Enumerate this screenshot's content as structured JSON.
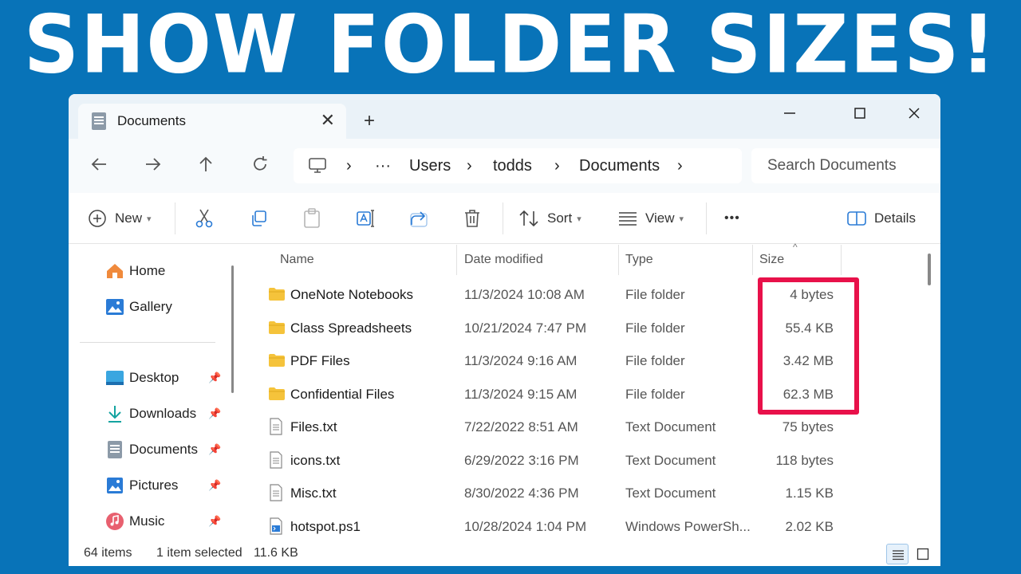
{
  "headline": "SHOW FOLDER SIZES!",
  "window": {
    "tab_title": "Documents",
    "new_tab_label": "+",
    "breadcrumb": [
      "Users",
      "todds",
      "Documents"
    ],
    "breadcrumb_more": "···",
    "search_placeholder": "Search Documents"
  },
  "toolbar": {
    "new_label": "New",
    "sort_label": "Sort",
    "view_label": "View",
    "more_label": "•••",
    "details_label": "Details"
  },
  "sidebar": {
    "quick": [
      {
        "label": "Home",
        "icon": "home-icon"
      },
      {
        "label": "Gallery",
        "icon": "gallery-icon"
      }
    ],
    "pinned": [
      {
        "label": "Desktop",
        "icon": "desktop-icon"
      },
      {
        "label": "Downloads",
        "icon": "download-icon"
      },
      {
        "label": "Documents",
        "icon": "document-icon"
      },
      {
        "label": "Pictures",
        "icon": "pictures-icon"
      },
      {
        "label": "Music",
        "icon": "music-icon"
      }
    ]
  },
  "columns": [
    "Name",
    "Date modified",
    "Type",
    "Size"
  ],
  "files": [
    {
      "name": "OneNote Notebooks",
      "date": "11/3/2024 10:08 AM",
      "type": "File folder",
      "size": "4 bytes",
      "icon": "folder-icon"
    },
    {
      "name": "Class Spreadsheets",
      "date": "10/21/2024 7:47 PM",
      "type": "File folder",
      "size": "55.4 KB",
      "icon": "folder-icon"
    },
    {
      "name": "PDF Files",
      "date": "11/3/2024 9:16 AM",
      "type": "File folder",
      "size": "3.42 MB",
      "icon": "folder-icon"
    },
    {
      "name": "Confidential Files",
      "date": "11/3/2024 9:15 AM",
      "type": "File folder",
      "size": "62.3 MB",
      "icon": "folder-icon"
    },
    {
      "name": "Files.txt",
      "date": "7/22/2022 8:51 AM",
      "type": "Text Document",
      "size": "75 bytes",
      "icon": "text-file-icon"
    },
    {
      "name": "icons.txt",
      "date": "6/29/2022 3:16 PM",
      "type": "Text Document",
      "size": "118 bytes",
      "icon": "text-file-icon"
    },
    {
      "name": "Misc.txt",
      "date": "8/30/2022 4:36 PM",
      "type": "Text Document",
      "size": "1.15 KB",
      "icon": "text-file-icon"
    },
    {
      "name": "hotspot.ps1",
      "date": "10/28/2024 1:04 PM",
      "type": "Windows PowerSh...",
      "size": "2.02 KB",
      "icon": "powershell-file-icon"
    }
  ],
  "status": {
    "item_count": "64 items",
    "selection": "1 item selected",
    "selection_size": "11.6 KB"
  },
  "colors": {
    "background": "#0873b8",
    "highlight": "#e8114a",
    "folder": "#f5c33b"
  }
}
